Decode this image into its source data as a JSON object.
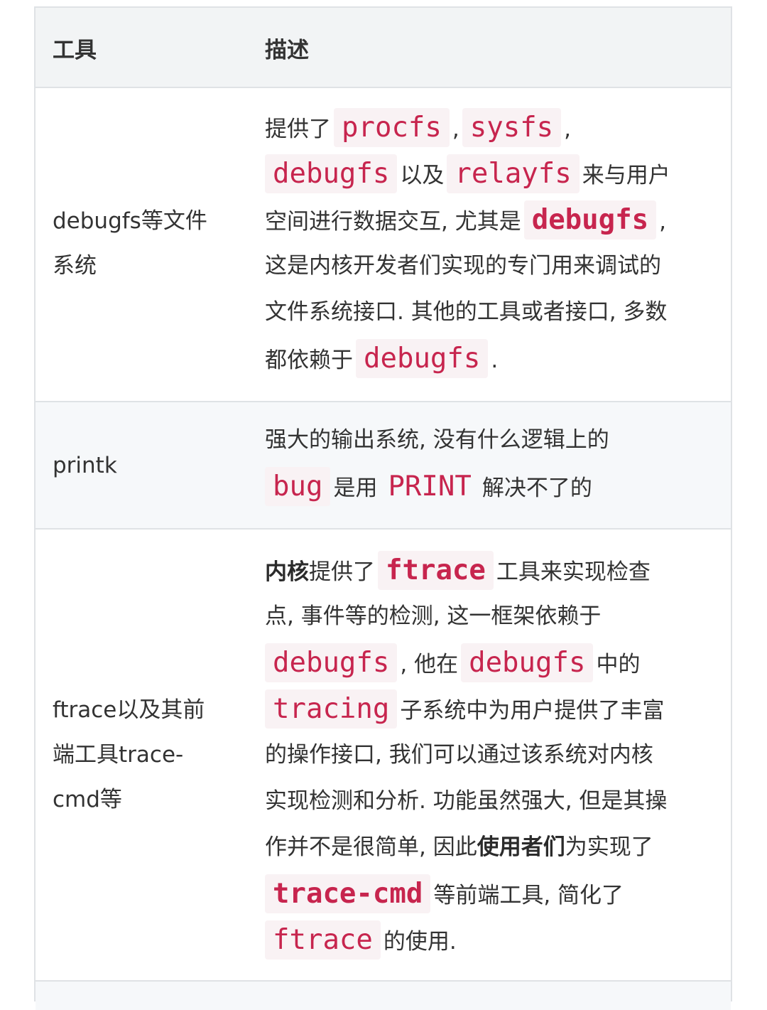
{
  "header": {
    "col_tool": "工具",
    "col_desc": "描述"
  },
  "rows": [
    {
      "tool_lines": [
        "debugfs等文件",
        "系统"
      ],
      "desc": {
        "l1a": "提供了",
        "l1c1": "procfs",
        "l1s1": ",",
        "l1c2": "sysfs",
        "l1s2": ",",
        "l2c1": "debugfs",
        "l2t1": "以及",
        "l2c2": "relayfs",
        "l2t2": "来与用户",
        "l3t": "空间进行数据交互, 尤其是",
        "l3c": "debugfs",
        "l3s": ",",
        "l4": "这是内核开发者们实现的专门用来调试的",
        "l5": "文件系统接口. 其他的工具或者接口, 多数",
        "l6t": "都依赖于",
        "l6c": "debugfs",
        "l6s": "."
      }
    },
    {
      "tool_lines": [
        "printk"
      ],
      "desc": {
        "l1": "强大的输出系统, 没有什么逻辑上的",
        "l2c1": "bug",
        "l2t1": "是用",
        "l2c2": "PRINT",
        "l2t2": "解决不了的"
      }
    },
    {
      "tool_lines": [
        "ftrace以及其前",
        "端工具trace-",
        "cmd等"
      ],
      "desc": {
        "l1b": "内核",
        "l1t": "提供了",
        "l1c": "ftrace",
        "l1t2": "工具来实现检查",
        "l2": "点, 事件等的检测, 这一框架依赖于",
        "l3c1": "debugfs",
        "l3t1": ", 他在",
        "l3c2": "debugfs",
        "l3t2": "中的",
        "l4c": "tracing",
        "l4t": "子系统中为用户提供了丰富",
        "l5": "的操作接口, 我们可以通过该系统对内核",
        "l6": "实现检测和分析. 功能虽然强大, 但是其操",
        "l7t": "作并不是很简单, 因此",
        "l7b": "使用者们",
        "l7t2": "为实现了",
        "l8c": "trace-cmd",
        "l8t": "等前端工具, 简化了",
        "l9c": "ftrace",
        "l9t": "的使用."
      }
    }
  ]
}
